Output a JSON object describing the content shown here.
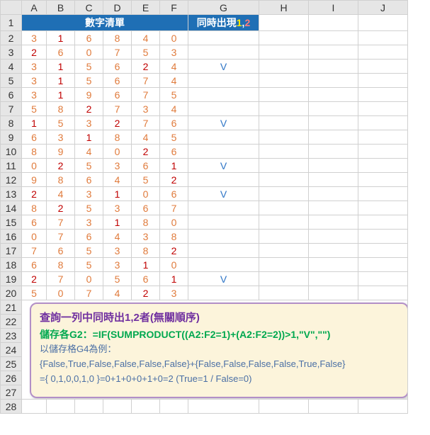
{
  "columns": [
    "A",
    "B",
    "C",
    "D",
    "E",
    "F",
    "G",
    "H",
    "I",
    "J"
  ],
  "rows": [
    1,
    2,
    3,
    4,
    5,
    6,
    7,
    8,
    9,
    10,
    11,
    12,
    13,
    14,
    15,
    16,
    17,
    18,
    19,
    20,
    21,
    22,
    23,
    24,
    25,
    26,
    27,
    28
  ],
  "header": {
    "title": "數字清單",
    "result_prefix": "同時出現",
    "result_one": "1",
    "result_comma": ",",
    "result_two": "2"
  },
  "chart_data": {
    "type": "table",
    "columns": [
      "A",
      "B",
      "C",
      "D",
      "E",
      "F",
      "G"
    ],
    "rows": [
      {
        "vals": [
          3,
          1,
          6,
          8,
          4,
          0
        ],
        "g": ""
      },
      {
        "vals": [
          2,
          6,
          0,
          7,
          5,
          3
        ],
        "g": ""
      },
      {
        "vals": [
          3,
          1,
          5,
          6,
          2,
          4
        ],
        "g": "V"
      },
      {
        "vals": [
          3,
          1,
          5,
          6,
          7,
          4
        ],
        "g": ""
      },
      {
        "vals": [
          3,
          1,
          9,
          6,
          7,
          5
        ],
        "g": ""
      },
      {
        "vals": [
          5,
          8,
          2,
          7,
          3,
          4
        ],
        "g": ""
      },
      {
        "vals": [
          1,
          5,
          3,
          2,
          7,
          6
        ],
        "g": "V"
      },
      {
        "vals": [
          6,
          3,
          1,
          8,
          4,
          5
        ],
        "g": ""
      },
      {
        "vals": [
          8,
          9,
          4,
          0,
          2,
          6
        ],
        "g": ""
      },
      {
        "vals": [
          0,
          2,
          5,
          3,
          6,
          1
        ],
        "g": "V"
      },
      {
        "vals": [
          9,
          8,
          6,
          4,
          5,
          2
        ],
        "g": ""
      },
      {
        "vals": [
          2,
          4,
          3,
          1,
          0,
          6
        ],
        "g": "V"
      },
      {
        "vals": [
          8,
          2,
          5,
          3,
          6,
          7
        ],
        "g": ""
      },
      {
        "vals": [
          6,
          7,
          3,
          1,
          8,
          0
        ],
        "g": ""
      },
      {
        "vals": [
          0,
          7,
          6,
          4,
          3,
          8
        ],
        "g": ""
      },
      {
        "vals": [
          7,
          6,
          5,
          3,
          8,
          2
        ],
        "g": ""
      },
      {
        "vals": [
          6,
          8,
          5,
          3,
          1,
          0
        ],
        "g": ""
      },
      {
        "vals": [
          2,
          7,
          0,
          5,
          6,
          1
        ],
        "g": "V"
      },
      {
        "vals": [
          5,
          0,
          7,
          4,
          2,
          3
        ],
        "g": ""
      }
    ]
  },
  "formula_box": {
    "line1": "查詢一列中同時出1,2者(無關順序)",
    "line2": "儲存各G2：=IF(SUMPRODUCT((A2:F2=1)+(A2:F2=2))>1,\"V\",\"\")",
    "line3": "以儲存格G4為例：",
    "line4": "{False,True,False,False,False,False}+{False,False,False,False,True,False}",
    "line5": "={ 0,1,0,0,1,0 }=0+1+0+0+1+0=2 (True=1 / False=0)"
  }
}
